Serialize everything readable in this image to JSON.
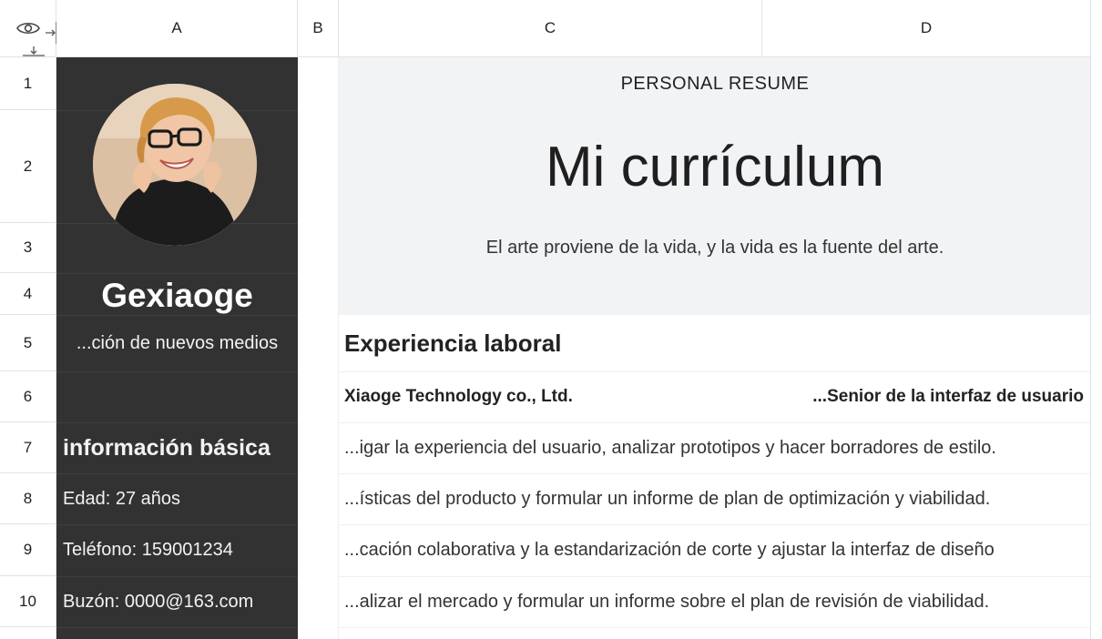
{
  "columns": [
    "A",
    "B",
    "C",
    "D"
  ],
  "rows": [
    "1",
    "2",
    "3",
    "4",
    "5",
    "6",
    "7",
    "8",
    "9",
    "10"
  ],
  "icons": {
    "view": "eye-icon",
    "freeze_cols": "freeze-columns-icon",
    "freeze_rows": "freeze-rows-icon",
    "photo": "profile-photo"
  },
  "profile": {
    "name": "Gexiaoge",
    "role": "...ción de nuevos medios"
  },
  "header": {
    "title": "PERSONAL RESUME",
    "heading": "Mi currículum",
    "quote": "El arte proviene de la vida, y la vida es la fuente del arte."
  },
  "basic": {
    "title": "información básica",
    "age": "Edad: 27 años",
    "phone": "Teléfono: 159001234",
    "email": "Buzón: 0000@163.com"
  },
  "experience": {
    "title": "Experiencia laboral",
    "company": "Xiaoge Technology co., Ltd.",
    "position": "...Senior de la interfaz de usuario",
    "items": [
      "...igar la experiencia del usuario, analizar prototipos y hacer borradores de estilo.",
      "...ísticas del producto y formular un informe de plan de optimización y viabilidad.",
      "...cación colaborativa y la estandarización de corte y ajustar la interfaz de diseño",
      "...alizar el mercado y formular un informe sobre el plan de revisión de viabilidad."
    ]
  },
  "colors": {
    "sidebar": "#323232",
    "band": "#f2f3f5",
    "grid": "#e2e2e2"
  }
}
